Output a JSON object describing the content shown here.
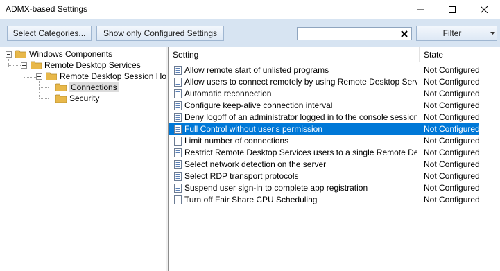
{
  "window": {
    "title": "ADMX-based Settings"
  },
  "toolbar": {
    "select_categories": "Select Categories...",
    "show_only_configured": "Show only Configured Settings",
    "search_value": "",
    "filter": "Filter"
  },
  "tree": {
    "n0": "Windows Components",
    "n1": "Remote Desktop Services",
    "n2": "Remote Desktop Session Host",
    "n3": "Connections",
    "n4": "Security"
  },
  "table": {
    "headers": {
      "setting": "Setting",
      "state": "State"
    },
    "rows": [
      {
        "setting": "Allow remote start of unlisted programs",
        "state": "Not Configured"
      },
      {
        "setting": "Allow users to connect remotely by using Remote Desktop Services",
        "state": "Not Configured"
      },
      {
        "setting": "Automatic reconnection",
        "state": "Not Configured"
      },
      {
        "setting": "Configure keep-alive connection interval",
        "state": "Not Configured"
      },
      {
        "setting": "Deny logoff of an administrator logged in to the console session",
        "state": "Not Configured"
      },
      {
        "setting": "Full Control without user's permission",
        "state": "Not Configured"
      },
      {
        "setting": "Limit number of connections",
        "state": "Not Configured"
      },
      {
        "setting": "Restrict Remote Desktop Services users to a single Remote Desktop ...",
        "state": "Not Configured"
      },
      {
        "setting": "Select network detection on the server",
        "state": "Not Configured"
      },
      {
        "setting": "Select RDP transport protocols",
        "state": "Not Configured"
      },
      {
        "setting": "Suspend user sign-in to complete app registration",
        "state": "Not Configured"
      },
      {
        "setting": "Turn off Fair Share CPU Scheduling",
        "state": "Not Configured"
      }
    ]
  },
  "colors": {
    "toolbar_bg": "#d7e4f2",
    "selection": "#0078d7",
    "folder": "#e8b84a"
  }
}
